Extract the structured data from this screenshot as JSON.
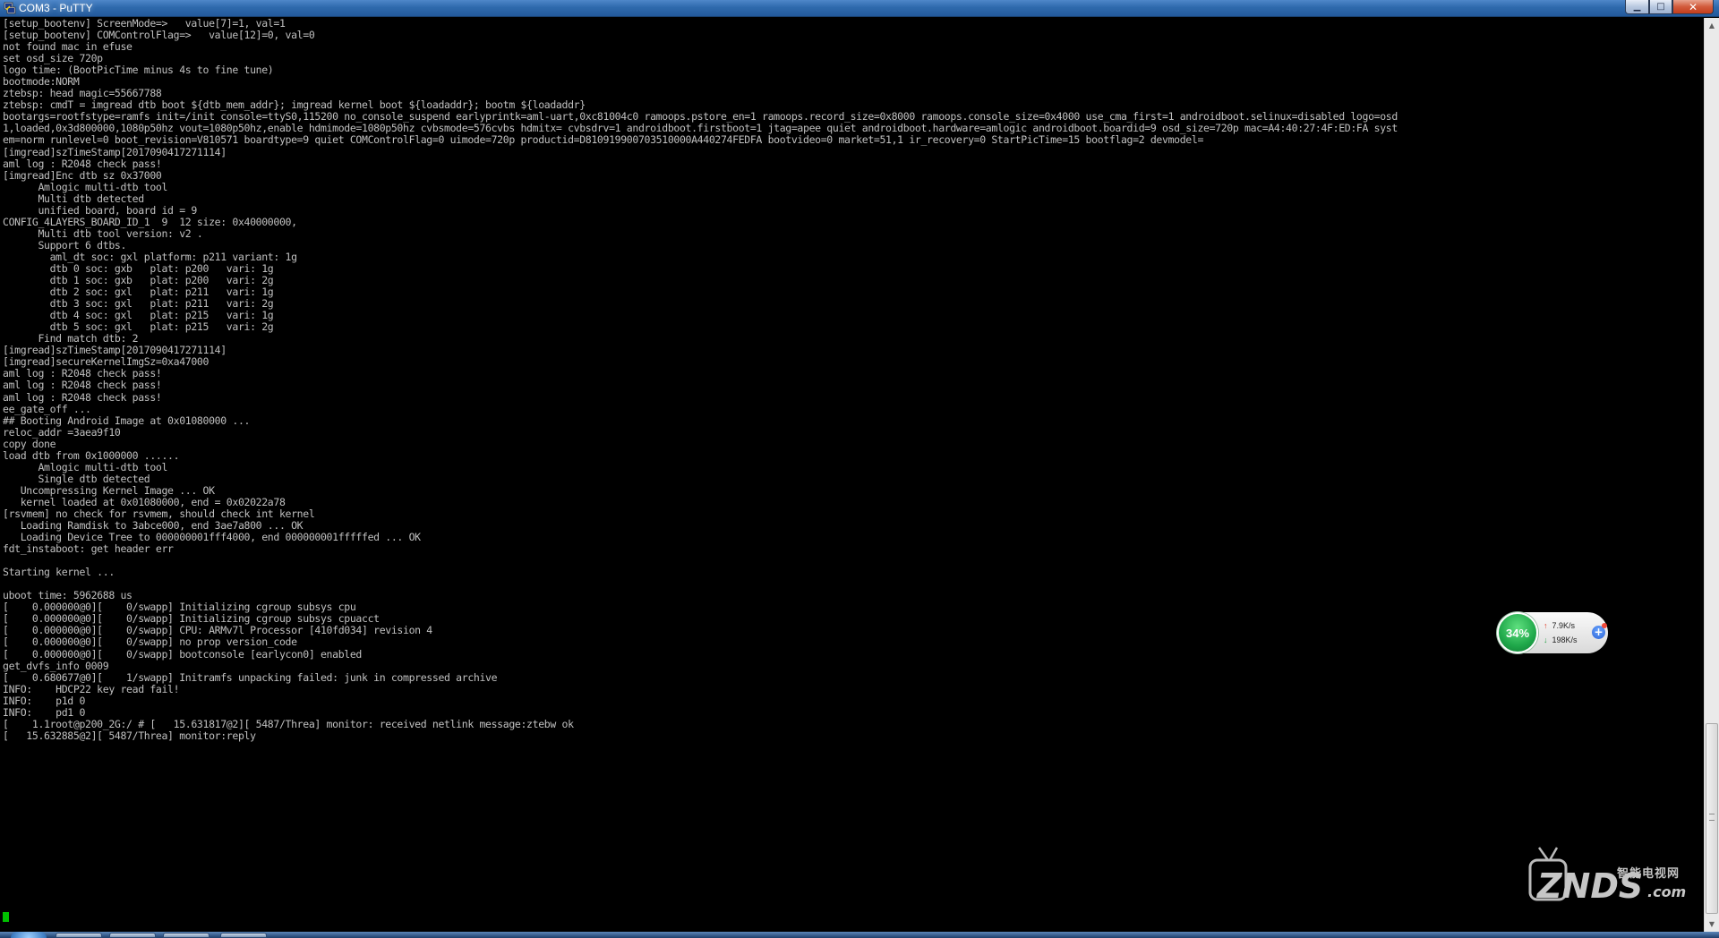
{
  "window": {
    "title": "COM3 - PuTTY",
    "minimize_glyph": "▁",
    "maximize_glyph": "□",
    "close_glyph": "✕"
  },
  "terminal": {
    "text": "[setup_bootenv] ScreenMode=>   value[7]=1, val=1\n[setup_bootenv] COMControlFlag=>   value[12]=0, val=0\nnot found mac in efuse\nset osd_size 720p\nlogo time: (BootPicTime minus 4s to fine tune)\nbootmode:NORM\nztebsp: head magic=55667788\nztebsp: cmdT = imgread dtb boot ${dtb_mem_addr}; imgread kernel boot ${loadaddr}; bootm ${loadaddr}\nbootargs=rootfstype=ramfs init=/init console=ttyS0,115200 no_console_suspend earlyprintk=aml-uart,0xc81004c0 ramoops.pstore_en=1 ramoops.record_size=0x8000 ramoops.console_size=0x4000 use_cma_first=1 androidboot.selinux=disabled logo=osd\n1,loaded,0x3d800000,1080p50hz vout=1080p50hz,enable hdmimode=1080p50hz cvbsmode=576cvbs hdmitx= cvbsdrv=1 androidboot.firstboot=1 jtag=apee quiet androidboot.hardware=amlogic androidboot.boardid=9 osd_size=720p mac=A4:40:27:4F:ED:FA syst\nem=norm runlevel=0 boot_revision=V810571 boardtype=9 quiet COMControlFlag=0 uimode=720p productid=D810919900703510000A440274FEDFA bootvideo=0 market=51,1 ir_recovery=0 StartPicTime=15 bootflag=2 devmodel=\n[imgread]szTimeStamp[2017090417271114]\naml log : R2048 check pass!\n[imgread]Enc dtb sz 0x37000\n      Amlogic multi-dtb tool\n      Multi dtb detected\n      unified board, board id = 9\nCONFIG_4LAYERS_BOARD_ID_1  9  12 size: 0x40000000,\n      Multi dtb tool version: v2 .\n      Support 6 dtbs.\n        aml_dt soc: gxl platform: p211 variant: 1g\n        dtb 0 soc: gxb   plat: p200   vari: 1g\n        dtb 1 soc: gxb   plat: p200   vari: 2g\n        dtb 2 soc: gxl   plat: p211   vari: 1g\n        dtb 3 soc: gxl   plat: p211   vari: 2g\n        dtb 4 soc: gxl   plat: p215   vari: 1g\n        dtb 5 soc: gxl   plat: p215   vari: 2g\n      Find match dtb: 2\n[imgread]szTimeStamp[2017090417271114]\n[imgread]secureKernelImgSz=0xa47000\naml log : R2048 check pass!\naml log : R2048 check pass!\naml log : R2048 check pass!\nee_gate_off ...\n## Booting Android Image at 0x01080000 ...\nreloc_addr =3aea9f10\ncopy done\nload dtb from 0x1000000 ......\n      Amlogic multi-dtb tool\n      Single dtb detected\n   Uncompressing Kernel Image ... OK\n   kernel loaded at 0x01080000, end = 0x02022a78\n[rsvmem] no check for rsvmem, should check int kernel\n   Loading Ramdisk to 3abce000, end 3ae7a800 ... OK\n   Loading Device Tree to 000000001fff4000, end 000000001fffffed ... OK\nfdt_instaboot: get header err\n\nStarting kernel ...\n\nuboot time: 5962688 us\n[    0.000000@0][    0/swapp] Initializing cgroup subsys cpu\n[    0.000000@0][    0/swapp] Initializing cgroup subsys cpuacct\n[    0.000000@0][    0/swapp] CPU: ARMv7l Processor [410fd034] revision 4\n[    0.000000@0][    0/swapp] no prop version_code\n[    0.000000@0][    0/swapp] bootconsole [earlycon0] enabled\nget_dvfs_info 0009\n[    0.680677@0][    1/swapp] Initramfs unpacking failed: junk in compressed archive\nINFO:    HDCP22 key read fail!\nINFO:    p1d 0\nINFO:    pd1 0\n[    1.1root@p200_2G:/ # [   15.631817@2][ 5487/Threa] monitor: received netlink message:ztebw ok\n[   15.632885@2][ 5487/Threa] monitor:reply"
  },
  "scrollbar": {
    "up_glyph": "▲",
    "down_glyph": "▼"
  },
  "net_widget": {
    "percent": "34%",
    "upload": "7.9K/s",
    "download": "198K/s",
    "up_arrow": "↑",
    "down_arrow": "↓",
    "plus": "+"
  },
  "watermark": {
    "brand": "ZNDS",
    "suffix": ".com",
    "chinese": "智能电视网"
  },
  "colors": {
    "terminal_bg": "#000000",
    "terminal_fg": "#c0c0c0",
    "cursor": "#00c000",
    "titlebar": "#2f6aad"
  }
}
